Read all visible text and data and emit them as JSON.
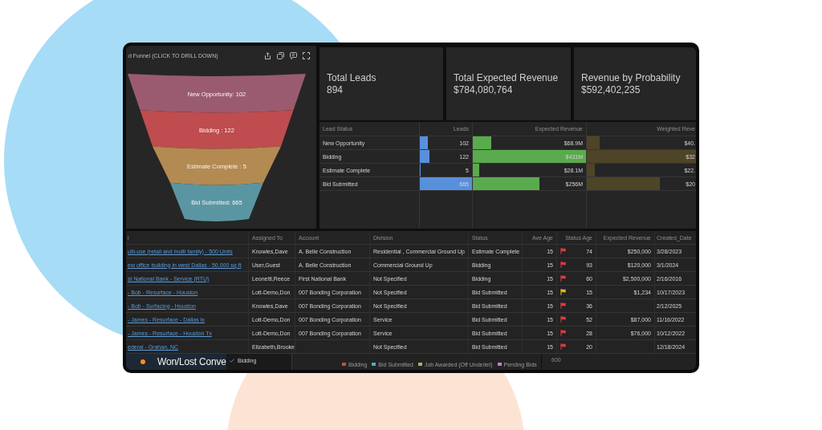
{
  "funnel_panel": {
    "title": "d Funnel (CLICK TO DRILL DOWN)",
    "slices": [
      {
        "label": "New Opportunity: 102",
        "color": "#9a5b70"
      },
      {
        "label": "Bidding : 122",
        "color": "#bf4c4e"
      },
      {
        "label": "Estimate Complete : 5",
        "color": "#b38a52"
      },
      {
        "label": "Bid Submitted: 665",
        "color": "#5a96a2"
      }
    ]
  },
  "kpis": [
    {
      "title": "Total Leads",
      "value": "894"
    },
    {
      "title": "Total Expected Revenue",
      "value": "$784,080,764"
    },
    {
      "title": "Revenue by Probability",
      "value": "$592,402,235"
    }
  ],
  "lead_table": {
    "columns": [
      "Lead Status",
      "Leads",
      "Expected Revenue",
      "Weighted Reve"
    ],
    "rows": [
      {
        "status": "New Opportunity",
        "leads": {
          "value": "102",
          "level": 0.15
        },
        "expected_revenue": {
          "value": "$68.9M",
          "level": 0.16
        },
        "weighted_revenue": {
          "value": "$40.",
          "level": 0.12
        }
      },
      {
        "status": "Bidding",
        "leads": {
          "value": "122",
          "level": 0.18
        },
        "expected_revenue": {
          "value": "$431M",
          "level": 1
        },
        "weighted_revenue": {
          "value": "$32",
          "level": 1
        }
      },
      {
        "status": "Estimate Complete",
        "leads": {
          "value": "5",
          "level": 0.01
        },
        "expected_revenue": {
          "value": "$28.1M",
          "level": 0.06
        },
        "weighted_revenue": {
          "value": "$22.",
          "level": 0.07
        }
      },
      {
        "status": "Bid Submitted",
        "leads": {
          "value": "665",
          "level": 1
        },
        "expected_revenue": {
          "value": "$256M",
          "level": 0.59
        },
        "weighted_revenue": {
          "value": "$20",
          "level": 0.67
        }
      }
    ]
  },
  "table": {
    "columns": [
      "l",
      "Assigned To",
      "Account",
      "Division",
      "Status",
      "Ave Age",
      "Status Age",
      "Expected Revenue",
      "Created_Date"
    ],
    "rows": [
      {
        "name": "ulti-use (retail and multi family) - 500 Units",
        "assigned_to": "Knowles,Dave",
        "account": "A. Belle Construction",
        "division": "Residential , Commercial Ground Up",
        "status": "Estimate Complete",
        "ave_age": "15",
        "flag": {
          "color": "#e0393e"
        },
        "status_age": "74",
        "expected_revenue": "$250,000",
        "created_date": "3/28/2023"
      },
      {
        "name": "ew office building in west Dallas - 50,000 sq ft",
        "assigned_to": "User,Guest",
        "account": "A. Belle Construction",
        "division": "Commercial Ground Up",
        "status": "Bidding",
        "ave_age": "15",
        "flag": {
          "color": "#e0393e"
        },
        "status_age": "93",
        "expected_revenue": "$120,000",
        "created_date": "3/1/2024"
      },
      {
        "name": "st National Bank - Service (RTU)",
        "assigned_to": "Leonetti,Reece",
        "account": "First National Bank",
        "division": "Not Specified",
        "status": "Bidding",
        "ave_age": "15",
        "flag": {
          "color": "#e0393e"
        },
        "status_age": "60",
        "expected_revenue": "$2,500,000",
        "created_date": "2/16/2016"
      },
      {
        "name": "- Bob - Resurface - Houston",
        "assigned_to": "Lott-Demo,Don",
        "account": "007 Bonding Corporation",
        "division": "Not Specified",
        "status": "Bid Submitted",
        "ave_age": "15",
        "flag": {
          "color": "#e8b41e"
        },
        "status_age": "15",
        "expected_revenue": "$1,234",
        "created_date": "10/17/2023"
      },
      {
        "name": "- Bob - Surfacing - Houston",
        "assigned_to": "Knowles,Dave",
        "account": "007 Bonding Corporation",
        "division": "Not Specified",
        "status": "Bid Submitted",
        "ave_age": "15",
        "flag": {
          "color": "#e0393e"
        },
        "status_age": "36",
        "created_date": "2/12/2025"
      },
      {
        "name": "- James - Resurface - Dallas tx",
        "assigned_to": "Lott-Demo,Don",
        "account": "007 Bonding Corporation",
        "division": "Service",
        "status": "Bid Submitted",
        "ave_age": "15",
        "flag": {
          "color": "#e0393e"
        },
        "status_age": "52",
        "expected_revenue": "$87,000",
        "created_date": "11/16/2022"
      },
      {
        "name": "- James - Resurface - Houston Tx",
        "assigned_to": "Lott-Demo,Don",
        "account": "007 Bonding Corporation",
        "division": "Service",
        "status": "Bid Submitted",
        "ave_age": "15",
        "flag": {
          "color": "#e0393e"
        },
        "status_age": "28",
        "expected_revenue": "$76,000",
        "created_date": "10/12/2022"
      },
      {
        "name": "ederal - Grahan, NC",
        "assigned_to": "Elizabeth,Brooke",
        "division": "Not Specified",
        "status": "Bid Submitted",
        "ave_age": "15",
        "flag": {
          "color": "#e0393e"
        },
        "status_age": "20",
        "created_date": "12/18/2024"
      }
    ]
  },
  "won_lost_panel": {
    "title": "Won/Lost Conve"
  },
  "series_toggle": {
    "label": "Bidding",
    "checked": true
  },
  "legend": [
    {
      "label": "Bidding",
      "color": "#c0504d"
    },
    {
      "label": "Bid Submitted",
      "color": "#4bacc6"
    },
    {
      "label": "Job Awarded (Off Underlet)",
      "color": "#9bbb59"
    },
    {
      "label": "Pending Bids",
      "color": "#c27fc2"
    }
  ],
  "axis_tick": "600"
}
